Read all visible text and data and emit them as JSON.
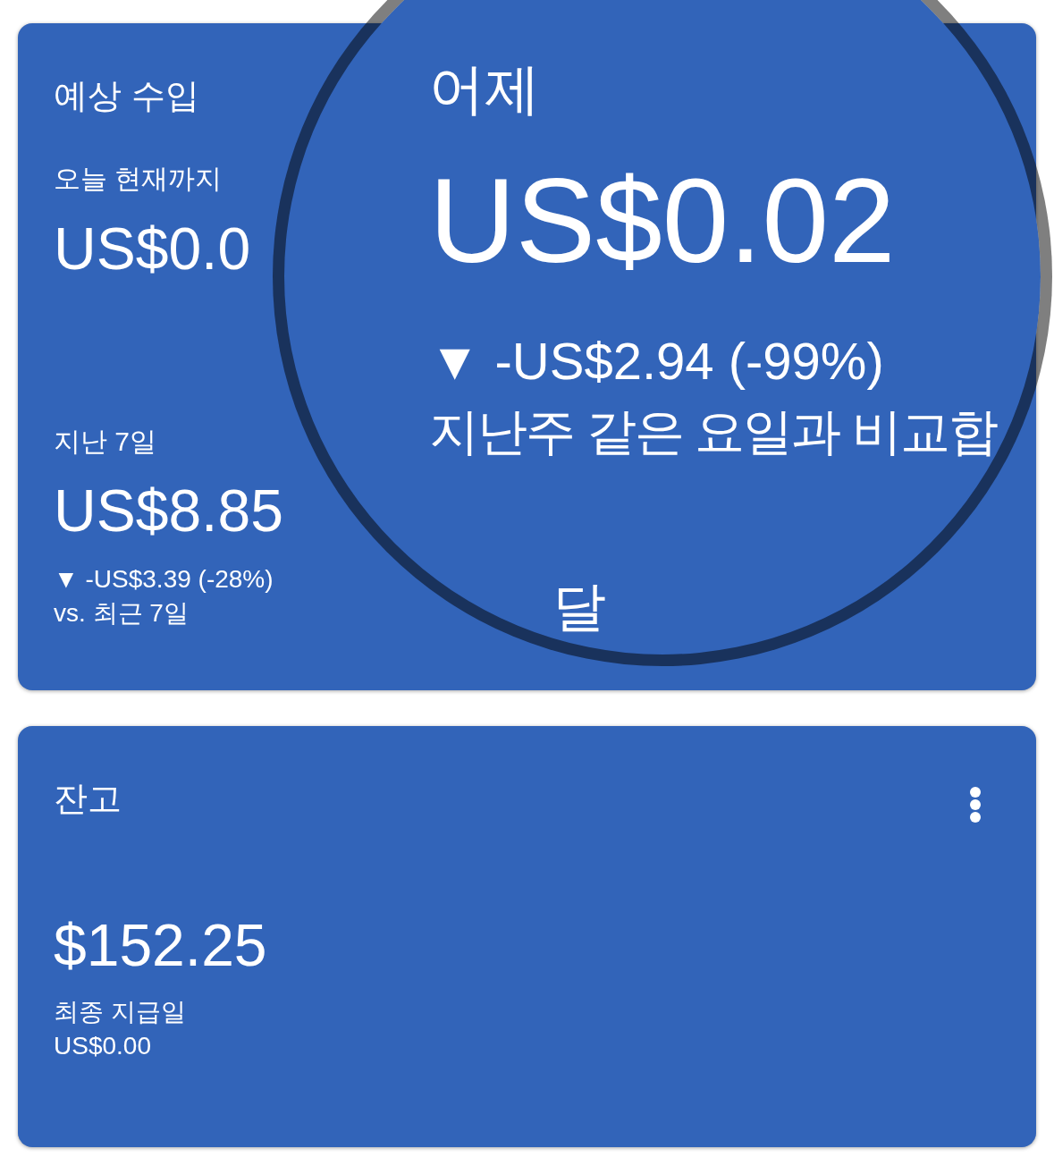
{
  "estimated_earnings": {
    "title": "예상 수입",
    "today": {
      "label": "오늘 현재까지",
      "value": "US$0.0"
    },
    "last_7_days": {
      "label": "지난 7일",
      "value": "US$8.85",
      "change": "▼ -US$3.39 (-28%)",
      "comparison": "vs. 최근 7일"
    }
  },
  "magnifier": {
    "label": "어제",
    "value": "US$0.02",
    "change": "▼ -US$2.94 (-99%)",
    "comparison": "지난주 같은 요일과 비교합",
    "next_label": "달"
  },
  "balance": {
    "title": "잔고",
    "value": "$152.25",
    "last_payment_label": "최종 지급일",
    "last_payment_value": "US$0.00"
  }
}
